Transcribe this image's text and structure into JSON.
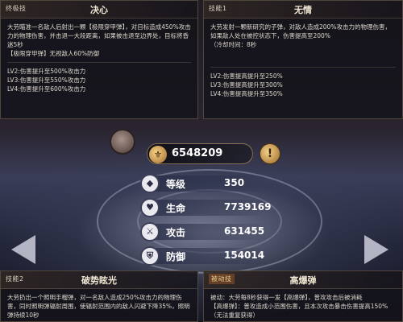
{
  "panels": {
    "top_left": {
      "tag": "终极技",
      "name": "决心",
      "description": "大劳瞄准一名敌人后射出一颗【极限穿甲弹】，对目标造成450%攻击力的物理伤害，并击退一大段距离，如果被击退至边界处，目标将昏迷5秒",
      "extra": "【极限穿甲弹】无视敌人60%防御",
      "levels": [
        "LV2:伤害提升至500%攻击力",
        "LV3:伤害提升至550%攻击力",
        "LV4:伤害提升至600%攻击力"
      ]
    },
    "top_right": {
      "tag": "技能1",
      "name": "无情",
      "description": "大劳发射一颗新研究的子弹，对敌人造成200%攻击力的物理伤害，如果敌人处在被控状态下，伤害提高至200%",
      "cooldown": "（冷却时间：8秒",
      "levels": [
        "LV2:伤害提高提升至250%",
        "LV3:伤害提高提升至300%",
        "LV4:伤害提高提升至350%"
      ]
    },
    "bottom_left": {
      "tag": "技能2",
      "name": "破势眩光",
      "description": "大劳扔出一个照明手榴弹，对一名敌人造成250%攻击力的物理伤害，同时照明弹辐射周围，使辐射范围内的敌人闪避下降35%，照明弹持续10秒"
    },
    "bottom_right": {
      "tag": "被动技",
      "name": "高爆弹",
      "description": "被动：大劳每8秒获得一发【高爆弹】，普攻攻击后被消耗",
      "extra": "【高爆弹】：普攻造成小范围伤害，且本次攻击暴击伤害提高150%（无法重复获得）"
    }
  },
  "power": {
    "value": "6548209",
    "icon": "power-icon"
  },
  "stats": [
    {
      "label": "等级",
      "value": "350",
      "icon": "level-icon"
    },
    {
      "label": "生命",
      "value": "7739169",
      "icon": "heart-icon"
    },
    {
      "label": "攻击",
      "value": "631455",
      "icon": "sword-icon"
    },
    {
      "label": "防御",
      "value": "154014",
      "icon": "shield-icon"
    }
  ],
  "colors": {
    "accent": "#c9a46a",
    "panel_bg": "#14121a"
  }
}
